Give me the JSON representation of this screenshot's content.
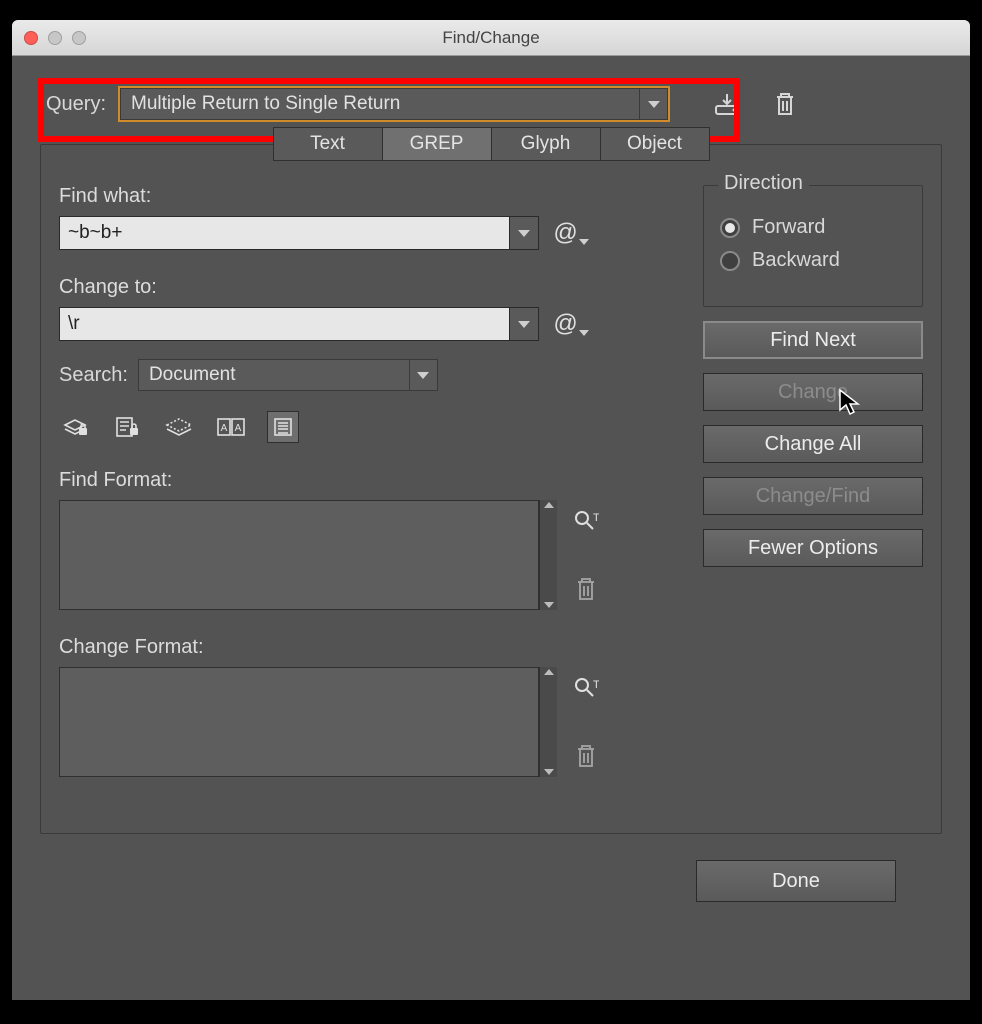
{
  "window": {
    "title": "Find/Change"
  },
  "query": {
    "label": "Query:",
    "selected": "Multiple Return to Single Return"
  },
  "tabs": [
    {
      "label": "Text"
    },
    {
      "label": "GREP"
    },
    {
      "label": "Glyph"
    },
    {
      "label": "Object"
    }
  ],
  "active_tab": "GREP",
  "find": {
    "label": "Find what:",
    "value": "~b~b+"
  },
  "change": {
    "label": "Change to:",
    "value": "\\r"
  },
  "search": {
    "label": "Search:",
    "selected": "Document"
  },
  "find_format": {
    "label": "Find Format:"
  },
  "change_format": {
    "label": "Change Format:"
  },
  "direction": {
    "legend": "Direction",
    "forward": "Forward",
    "backward": "Backward",
    "selected": "Forward"
  },
  "buttons": {
    "find_next": "Find Next",
    "change": "Change",
    "change_all": "Change All",
    "change_find": "Change/Find",
    "fewer_options": "Fewer Options",
    "done": "Done"
  },
  "option_icons": [
    "locked-layers-icon",
    "locked-stories-icon",
    "hidden-layers-icon",
    "master-pages-icon",
    "footnotes-icon"
  ]
}
